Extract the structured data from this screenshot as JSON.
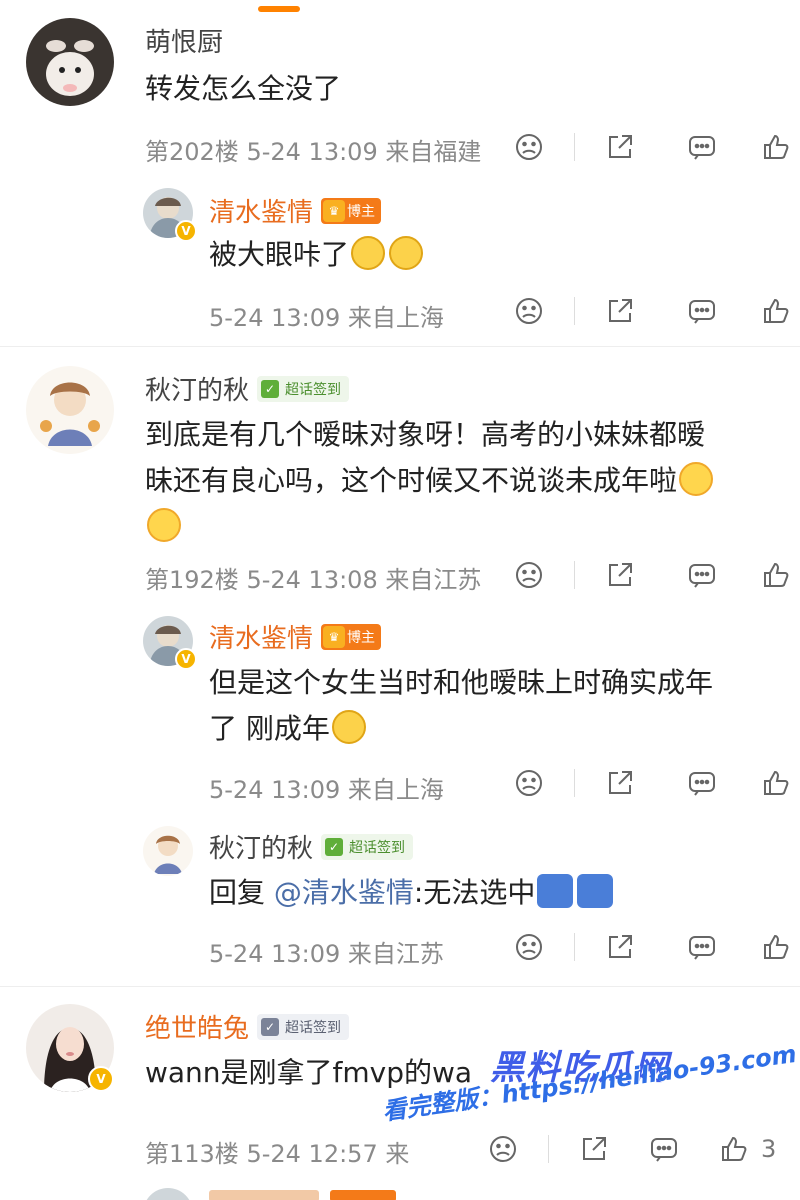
{
  "comments": [
    {
      "name": "萌恨厨",
      "text": "转发怎么全没了",
      "floor": "第202楼",
      "time": "5-24 13:09",
      "location": "来自福建"
    },
    {
      "name": "清水鉴情",
      "badge": "博主",
      "text": "被大眼咔了",
      "time": "5-24 13:09",
      "location": "来自上海"
    },
    {
      "name": "秋汀的秋",
      "badge": "超话签到",
      "text_line1": "到底是有几个暧昧对象呀！高考的小妹妹都暧",
      "text_line2": "昧还有良心吗，这个时候又不说谈未成年啦",
      "floor": "第192楼",
      "time": "5-24 13:08",
      "location": "来自江苏"
    },
    {
      "name": "清水鉴情",
      "badge": "博主",
      "text_line1": "但是这个女生当时和他暧昧上时确实成年",
      "text_line2": "了 刚成年",
      "time": "5-24 13:09",
      "location": "来自上海"
    },
    {
      "name": "秋汀的秋",
      "badge": "超话签到",
      "reply_prefix": "回复 ",
      "mention": "@清水鉴情",
      "text": ":无法选中",
      "time": "5-24 13:09",
      "location": "来自江苏"
    },
    {
      "name": "绝世皓兔",
      "badge": "超话签到",
      "text": "wann是刚拿了fmvp的wa",
      "floor": "第113楼",
      "time": "5-24 12:57",
      "location": "来",
      "like_count": "3"
    }
  ],
  "watermark": {
    "title": "黑料吃瓜网",
    "url": "看完整版：https://heiliao-93.com"
  },
  "colors": {
    "accent": "#ff8200",
    "host_badge": "#f47a18",
    "sign_badge": "#5fae39",
    "mention": "#4b6ea8"
  }
}
